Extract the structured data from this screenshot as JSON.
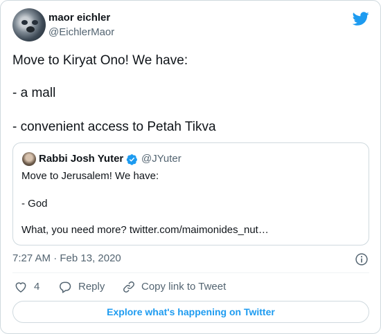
{
  "author": {
    "name": "maor eichler",
    "handle": "@EichlerMaor"
  },
  "tweet": {
    "lines": [
      "Move to Kiryat Ono! We have:",
      "- a mall",
      "- convenient access to Petah Tikva"
    ]
  },
  "quoted": {
    "name": "Rabbi Josh Yuter",
    "handle": "@JYuter",
    "verified": true,
    "lines": [
      "Move to Jerusalem! We have:",
      "- God",
      "What, you need more? twitter.com/maimonides_nut…"
    ]
  },
  "timestamp": "7:27 AM · Feb 13, 2020",
  "actions": {
    "like_count": "4",
    "reply_label": "Reply",
    "copy_link_label": "Copy link to Tweet"
  },
  "explore_label": "Explore what's happening on Twitter",
  "colors": {
    "brand": "#1d9bf0",
    "secondary_text": "#536471",
    "border": "#cfd9de"
  },
  "icons": [
    "twitter-logo-icon",
    "verified-badge-icon",
    "info-icon",
    "heart-icon",
    "reply-icon",
    "link-icon"
  ]
}
